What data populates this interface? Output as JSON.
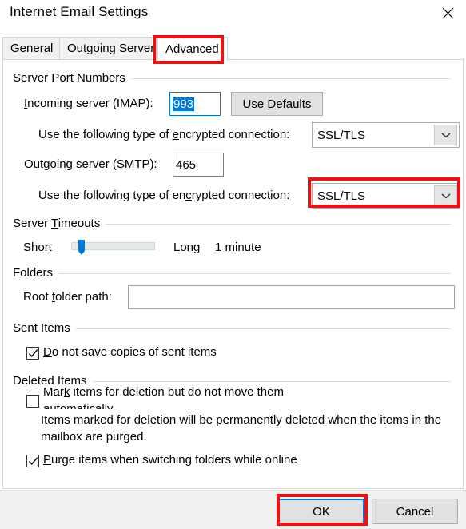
{
  "window": {
    "title": "Internet Email Settings",
    "close_icon": "close-icon"
  },
  "tabs": [
    {
      "label": "General",
      "selected": false
    },
    {
      "label": "Outgoing Server",
      "selected": false
    },
    {
      "label": "Advanced",
      "selected": true
    }
  ],
  "groups": {
    "server_port_numbers": {
      "title": "Server Port Numbers",
      "incoming_label": "Incoming server (IMAP):",
      "incoming_value": "993",
      "use_defaults_label": "Use Defaults",
      "incoming_encryption_label": "Use the following type of encrypted connection:",
      "incoming_encryption_value": "SSL/TLS",
      "outgoing_label": "Outgoing server (SMTP):",
      "outgoing_value": "465",
      "outgoing_encryption_label": "Use the following type of encrypted connection:",
      "outgoing_encryption_value": "SSL/TLS"
    },
    "server_timeouts": {
      "title": "Server Timeouts",
      "short_label": "Short",
      "long_label": "Long",
      "value_label": "1 minute",
      "slider_percent": 9
    },
    "folders": {
      "title": "Folders",
      "root_folder_label": "Root folder path:",
      "root_folder_value": ""
    },
    "sent_items": {
      "title": "Sent Items",
      "do_not_save_label": "Do not save copies of sent items",
      "do_not_save_checked": true
    },
    "deleted_items": {
      "title": "Deleted Items",
      "mark_items_label": "Mark items for deletion but do not move them automatically",
      "mark_items_checked": false,
      "hint_text": "Items marked for deletion will be permanently deleted when the items in the mailbox are purged.",
      "purge_label": "Purge items when switching folders while online",
      "purge_checked": true
    }
  },
  "footer": {
    "ok_label": "OK",
    "cancel_label": "Cancel"
  },
  "annotations": {
    "color": "#ee1111",
    "targets": [
      "tab-advanced",
      "outgoing-encryption-combo",
      "ok-button"
    ]
  }
}
